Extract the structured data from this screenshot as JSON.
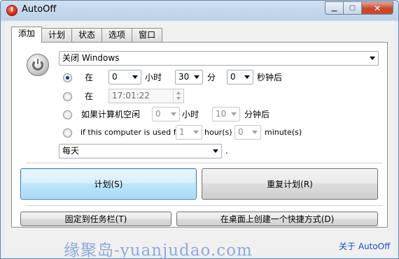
{
  "window": {
    "title": "AutoOff",
    "minimize_symbol": "▁",
    "maximize_symbol": "▢",
    "close_symbol": "✕"
  },
  "tabs": [
    {
      "label": "添加",
      "active": true
    },
    {
      "label": "计划",
      "active": false
    },
    {
      "label": "状态",
      "active": false
    },
    {
      "label": "选项",
      "active": false
    },
    {
      "label": "窗口",
      "active": false
    }
  ],
  "action": {
    "selected": "关闭 Windows"
  },
  "rows": {
    "at_time": {
      "label": "在",
      "hours": "0",
      "hours_unit": "小时",
      "minutes": "30",
      "minutes_unit": "分",
      "seconds": "0",
      "seconds_unit": "秒钟后",
      "selected": true
    },
    "at_clock": {
      "label": "在",
      "time": "17:01:22",
      "selected": false
    },
    "idle": {
      "label": "如果计算机空闲",
      "hours": "0",
      "hours_unit": "小时",
      "minutes": "10",
      "minutes_unit": "分钟后",
      "selected": false
    },
    "used": {
      "label": "if this computer is used for",
      "hours": "1",
      "hours_unit": "hour(s)",
      "minutes": "0",
      "minutes_unit": "minute(s)",
      "selected": false
    }
  },
  "repeat": {
    "selected": "每天",
    "suffix": "."
  },
  "buttons": {
    "schedule": "计划(S)",
    "reschedule": "重复计划(R)",
    "pin_taskbar": "固定到任务栏(T)",
    "desktop_shortcut": "在桌面上创建一个快捷方式(D)"
  },
  "footer": {
    "watermark": "缘聚岛-yuanjudao.com",
    "about": "关于 AutoOff"
  },
  "colors": {
    "accent": "#3c7fb1",
    "link": "#1a50b5",
    "watermark": "#8fa9d9"
  }
}
